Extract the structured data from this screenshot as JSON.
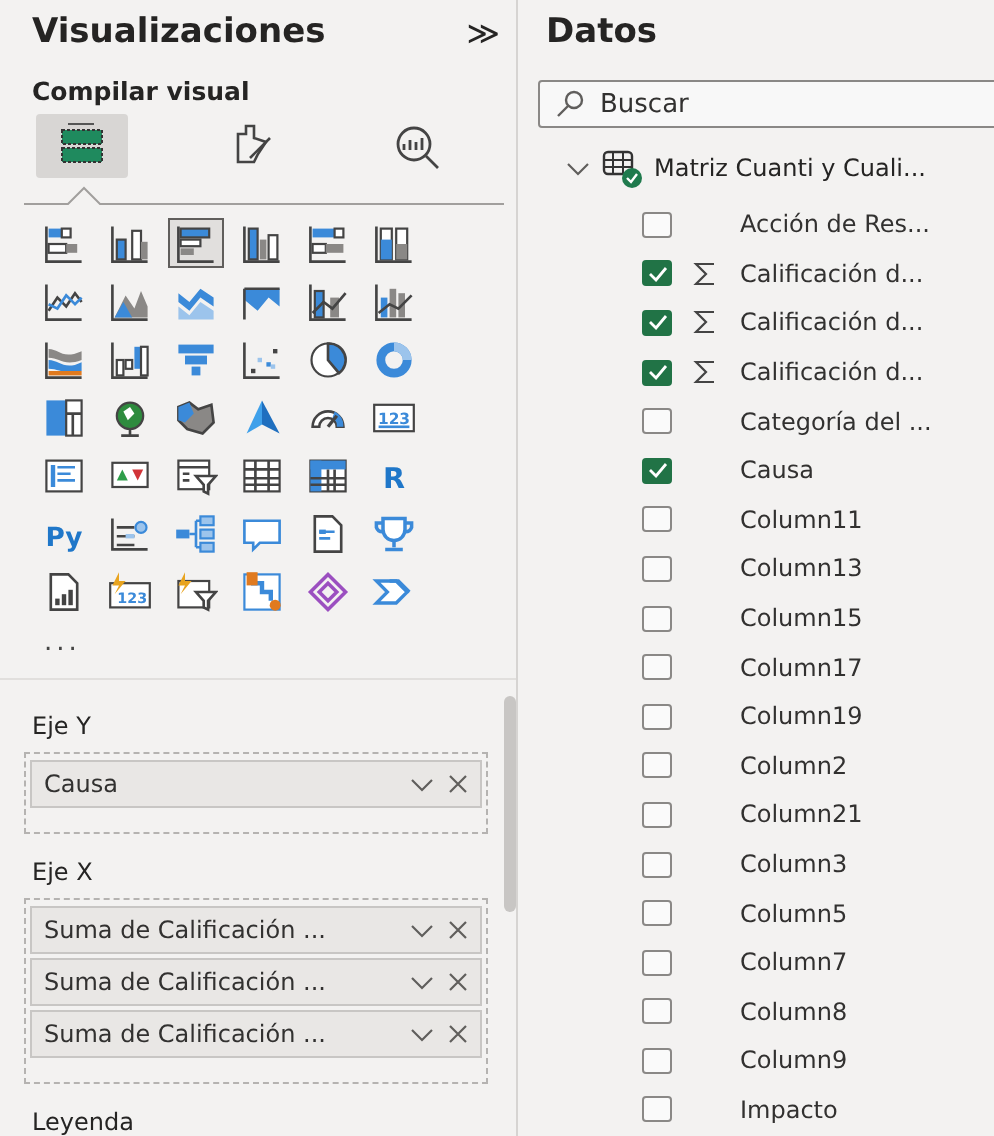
{
  "visualizations": {
    "title": "Visualizaciones",
    "collapse": "≫",
    "subtitle": "Compilar visual",
    "build_tabs": [
      {
        "kind": "fields",
        "selected": true
      },
      {
        "kind": "format",
        "selected": false
      },
      {
        "kind": "analytics",
        "selected": false
      }
    ],
    "gallery": [
      {
        "kind": "stacked-bar",
        "selected": false
      },
      {
        "kind": "stacked-column",
        "selected": false
      },
      {
        "kind": "clustered-bar",
        "selected": true
      },
      {
        "kind": "clustered-column",
        "selected": false
      },
      {
        "kind": "full-bar",
        "selected": false
      },
      {
        "kind": "full-column",
        "selected": false
      },
      {
        "kind": "line",
        "selected": false
      },
      {
        "kind": "area",
        "selected": false
      },
      {
        "kind": "stacked-area",
        "selected": false
      },
      {
        "kind": "band-area",
        "selected": false
      },
      {
        "kind": "line-column",
        "selected": false
      },
      {
        "kind": "line-clustered",
        "selected": false
      },
      {
        "kind": "ribbon",
        "selected": false
      },
      {
        "kind": "waterfall",
        "selected": false
      },
      {
        "kind": "funnel",
        "selected": false
      },
      {
        "kind": "scatter",
        "selected": false
      },
      {
        "kind": "pie",
        "selected": false
      },
      {
        "kind": "donut",
        "selected": false
      },
      {
        "kind": "treemap",
        "selected": false
      },
      {
        "kind": "globe",
        "selected": false
      },
      {
        "kind": "filled-map",
        "selected": false
      },
      {
        "kind": "azure-map",
        "selected": false
      },
      {
        "kind": "gauge",
        "selected": false
      },
      {
        "kind": "card",
        "text": "123",
        "selected": false
      },
      {
        "kind": "multirow",
        "selected": false
      },
      {
        "kind": "kpi",
        "selected": false
      },
      {
        "kind": "slicer",
        "selected": false
      },
      {
        "kind": "table",
        "selected": false
      },
      {
        "kind": "matrix",
        "selected": false
      },
      {
        "kind": "letters",
        "text": "R",
        "selected": false
      },
      {
        "kind": "letters",
        "text": "Py",
        "selected": false
      },
      {
        "kind": "influencers",
        "selected": false
      },
      {
        "kind": "decomposition",
        "selected": false
      },
      {
        "kind": "qa",
        "selected": false
      },
      {
        "kind": "narrative",
        "selected": false
      },
      {
        "kind": "goals",
        "selected": false
      },
      {
        "kind": "paginated",
        "selected": false
      },
      {
        "kind": "new-card",
        "text": "123",
        "selected": false
      },
      {
        "kind": "new-slicer",
        "selected": false
      },
      {
        "kind": "apps",
        "selected": false
      },
      {
        "kind": "automate",
        "selected": false
      },
      {
        "kind": "chevrons",
        "selected": false
      }
    ],
    "more": "...",
    "wells": [
      {
        "title": "Eje Y",
        "fields": [
          "Causa"
        ]
      },
      {
        "title": "Eje X",
        "fields": [
          "Suma de Calificación ...",
          "Suma de Calificación ...",
          "Suma de Calificación ..."
        ]
      },
      {
        "title": "Leyenda"
      }
    ]
  },
  "data": {
    "title": "Datos",
    "search": {
      "placeholder": "Buscar"
    },
    "table": {
      "name": "Matriz Cuanti y Cuali...",
      "expanded": true,
      "fields": [
        {
          "label": "Acción de Res...",
          "kind": "column",
          "checked": false
        },
        {
          "label": "Calificación d...",
          "kind": "measure",
          "checked": true
        },
        {
          "label": "Calificación d...",
          "kind": "measure",
          "checked": true
        },
        {
          "label": "Calificación d...",
          "kind": "measure",
          "checked": true
        },
        {
          "label": "Categoría del ...",
          "kind": "column",
          "checked": false
        },
        {
          "label": "Causa",
          "kind": "column",
          "checked": true
        },
        {
          "label": "Column11",
          "kind": "column",
          "checked": false
        },
        {
          "label": "Column13",
          "kind": "column",
          "checked": false
        },
        {
          "label": "Column15",
          "kind": "column",
          "checked": false
        },
        {
          "label": "Column17",
          "kind": "column",
          "checked": false
        },
        {
          "label": "Column19",
          "kind": "column",
          "checked": false
        },
        {
          "label": "Column2",
          "kind": "column",
          "checked": false
        },
        {
          "label": "Column21",
          "kind": "column",
          "checked": false
        },
        {
          "label": "Column3",
          "kind": "column",
          "checked": false
        },
        {
          "label": "Column5",
          "kind": "column",
          "checked": false
        },
        {
          "label": "Column7",
          "kind": "column",
          "checked": false
        },
        {
          "label": "Column8",
          "kind": "column",
          "checked": false
        },
        {
          "label": "Column9",
          "kind": "column",
          "checked": false
        },
        {
          "label": "Impacto",
          "kind": "column",
          "checked": false
        }
      ]
    }
  }
}
